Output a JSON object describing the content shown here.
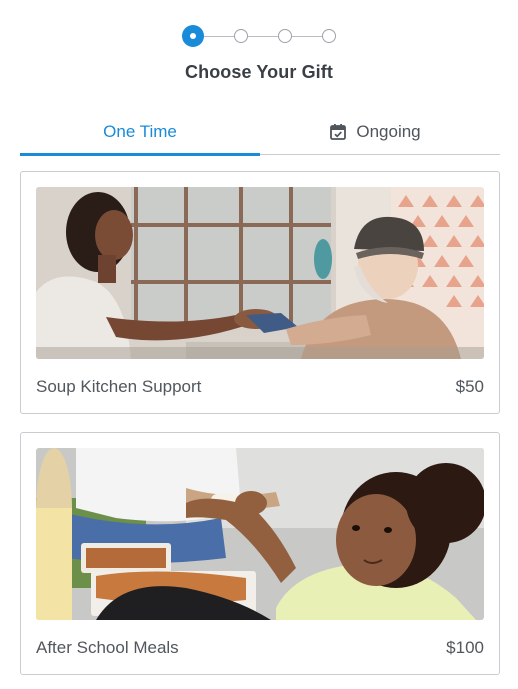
{
  "stepper": {
    "total_steps": 4,
    "current_step": 1
  },
  "page_title": "Choose Your Gift",
  "tabs": [
    {
      "label": "One Time",
      "active": true
    },
    {
      "label": "Ongoing",
      "active": false,
      "icon": "calendar-icon"
    }
  ],
  "gifts": [
    {
      "name": "Soup Kitchen Support",
      "price": "$50"
    },
    {
      "name": "After School Meals",
      "price": "$100"
    }
  ],
  "colors": {
    "accent": "#1a8bd9",
    "text": "#3a3f45",
    "border": "#c9ccd0"
  }
}
